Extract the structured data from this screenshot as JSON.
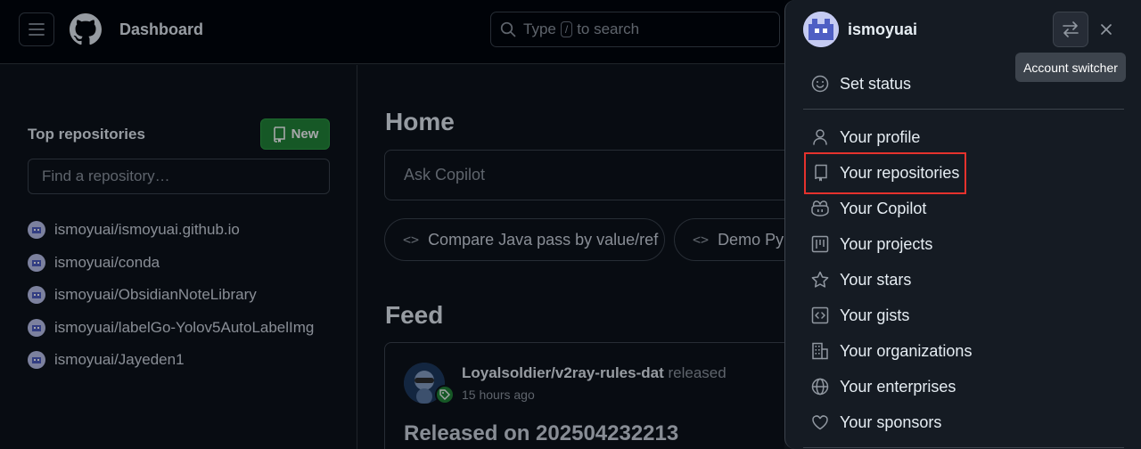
{
  "header": {
    "context_title": "Dashboard",
    "search": {
      "placeholder_before": "Type",
      "shortcut_key": "/",
      "placeholder_after": "to search"
    }
  },
  "sidebar": {
    "title": "Top repositories",
    "new_button": "New",
    "find_placeholder": "Find a repository…",
    "repos": [
      "ismoyuai/ismoyuai.github.io",
      "ismoyuai/conda",
      "ismoyuai/ObsidianNoteLibrary",
      "ismoyuai/labelGo-Yolov5AutoLabelImg",
      "ismoyuai/Jayeden1"
    ]
  },
  "main": {
    "home_title": "Home",
    "copilot_placeholder": "Ask Copilot",
    "suggestions": [
      "Compare Java pass by value/ref",
      "Demo Py"
    ],
    "feed_title": "Feed",
    "feed_item": {
      "repo": "Loyalsoldier/v2ray-rules-dat",
      "action": "released",
      "time": "15 hours ago",
      "release_title": "Released on 202504232213"
    }
  },
  "panel": {
    "username": "ismoyuai",
    "tooltip": "Account switcher",
    "status_item": "Set status",
    "menu": [
      {
        "label": "Your profile",
        "icon": "person-icon"
      },
      {
        "label": "Your repositories",
        "icon": "repo-icon"
      },
      {
        "label": "Your Copilot",
        "icon": "copilot-icon"
      },
      {
        "label": "Your projects",
        "icon": "project-icon"
      },
      {
        "label": "Your stars",
        "icon": "star-icon"
      },
      {
        "label": "Your gists",
        "icon": "code-square-icon"
      },
      {
        "label": "Your organizations",
        "icon": "organization-icon"
      },
      {
        "label": "Your enterprises",
        "icon": "globe-icon"
      },
      {
        "label": "Your sponsors",
        "icon": "heart-icon"
      }
    ],
    "highlighted_item": "Your repositories"
  },
  "colors": {
    "background": "#0d1117",
    "header": "#010409",
    "panel": "#151b23",
    "accent_green": "#238636",
    "highlight_red": "#e5322d"
  }
}
